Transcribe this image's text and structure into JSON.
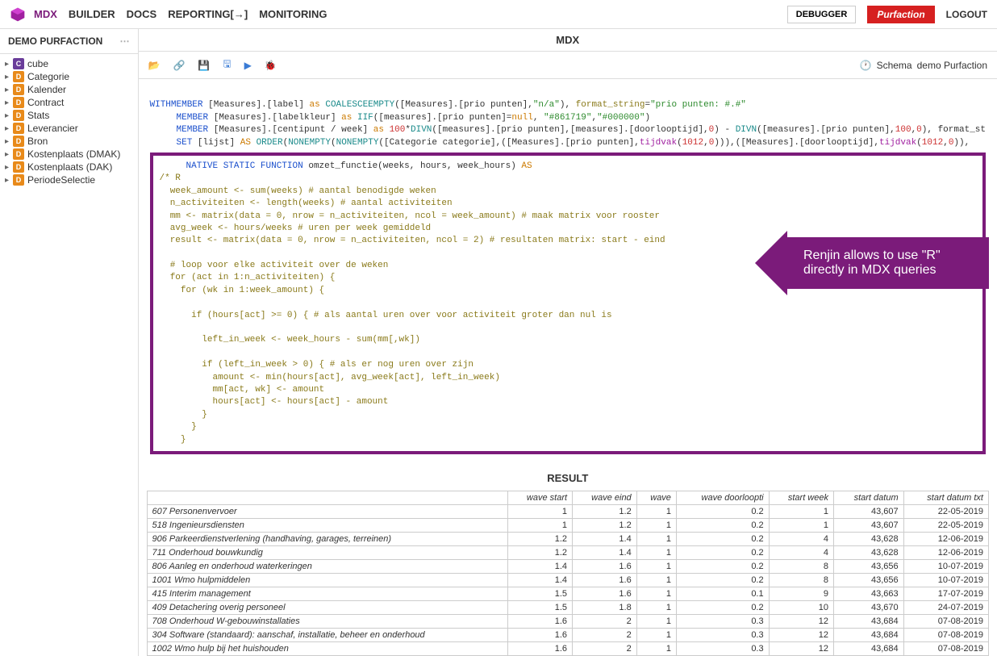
{
  "nav": {
    "items": [
      "MDX",
      "BUILDER",
      "DOCS",
      "REPORTING[→]",
      "MONITORING"
    ],
    "active": 0
  },
  "topbar": {
    "debugger": "DEBUGGER",
    "brand": "Purfaction",
    "logout": "LOGOUT"
  },
  "sidebar": {
    "title": "DEMO PURFACTION",
    "items": [
      {
        "badge": "C",
        "label": "cube"
      },
      {
        "badge": "D",
        "label": "Categorie"
      },
      {
        "badge": "D",
        "label": "Kalender"
      },
      {
        "badge": "D",
        "label": "Contract"
      },
      {
        "badge": "D",
        "label": "Stats"
      },
      {
        "badge": "D",
        "label": "Leverancier"
      },
      {
        "badge": "D",
        "label": "Bron"
      },
      {
        "badge": "D",
        "label": "Kostenplaats (DMAK)"
      },
      {
        "badge": "D",
        "label": "Kostenplaats (DAK)"
      },
      {
        "badge": "D",
        "label": "PeriodeSelectie"
      }
    ]
  },
  "section": {
    "mdx": "MDX",
    "result": "RESULT"
  },
  "toolbar": {
    "schema_label": "Schema",
    "schema_value": "demo Purfaction"
  },
  "callout": {
    "line1": "Renjin allows to use \"R\"",
    "line2": "directly in MDX queries"
  },
  "code": {
    "with": "WITH",
    "member": "MEMBER",
    "as": "as",
    "AS": "AS",
    "set": "SET",
    "m1": " [Measures].[label] ",
    "coal": "COALESCEEMPTY",
    "coal_args": "([Measures].[prio punten],",
    "na": "\"n/a\"",
    "paren": "),",
    "fs": " format_string",
    "eq": "=",
    "fs_val": "\"prio punten: #.#\"",
    "m2": " [Measures].[labelkleur] ",
    "iif": "IIF",
    "iif_args": "([measures].[prio punten]=",
    "null": "null",
    "c1": "\"#861719\"",
    "c2": "\"#000000\"",
    "m3": " [Measures].[centipunt / week] ",
    "hundred": "100",
    "star": "*",
    "divn": "DIVN",
    "divn1": "([measures].[prio punten],[measures].[doorlooptijd],",
    "zero": "0",
    "minus": " - ",
    "divn2": "([measures].[prio punten],",
    "h100": "100",
    "divn3": "), format_st",
    "lijst": " [lijst] ",
    "order": "ORDER",
    "none": "NONEMPTY",
    "none_args": "([Categorie categorie],([Measures].[prio punten],",
    "tijdvak": "tijdvak",
    "t1": "(",
    "n1012": "1012",
    "t2": ",",
    "t3": "))),([Measures].[doorlooptijd],",
    "t4": ")),",
    "nsf": "NATIVE STATIC FUNCTION",
    "nsf_tail": " omzet_functie(weeks, hours, week_hours) ",
    "r_body": "/* R\n  week_amount <- sum(weeks) # aantal benodigde weken\n  n_activiteiten <- length(weeks) # aantal activiteiten\n  mm <- matrix(data = 0, nrow = n_activiteiten, ncol = week_amount) # maak matrix voor rooster\n  avg_week <- hours/weeks # uren per week gemiddeld\n  result <- matrix(data = 0, nrow = n_activiteiten, ncol = 2) # resultaten matrix: start - eind\n\n  # loop voor elke activiteit over de weken\n  for (act in 1:n_activiteiten) {\n    for (wk in 1:week_amount) {\n\n      if (hours[act] >= 0) { # als aantal uren over voor activiteit groter dan nul is\n\n        left_in_week <- week_hours - sum(mm[,wk])\n\n        if (left_in_week > 0) { # als er nog uren over zijn\n          amount <- min(hours[act], avg_week[act], left_in_week)\n          mm[act, wk] <- amount\n          hours[act] <- hours[act] - amount\n        }\n      }\n    }"
  },
  "result": {
    "headers": [
      "",
      "wave start",
      "wave eind",
      "wave",
      "wave doorloopti",
      "start week",
      "start datum",
      "start datum txt"
    ],
    "rows": [
      [
        "607 Personenvervoer",
        "1",
        "1.2",
        "1",
        "0.2",
        "1",
        "43,607",
        "22-05-2019"
      ],
      [
        "518 Ingenieursdiensten",
        "1",
        "1.2",
        "1",
        "0.2",
        "1",
        "43,607",
        "22-05-2019"
      ],
      [
        "906 Parkeerdienstverlening (handhaving, garages, terreinen)",
        "1.2",
        "1.4",
        "1",
        "0.2",
        "4",
        "43,628",
        "12-06-2019"
      ],
      [
        "711 Onderhoud bouwkundig",
        "1.2",
        "1.4",
        "1",
        "0.2",
        "4",
        "43,628",
        "12-06-2019"
      ],
      [
        "806 Aanleg en onderhoud waterkeringen",
        "1.4",
        "1.6",
        "1",
        "0.2",
        "8",
        "43,656",
        "10-07-2019"
      ],
      [
        "1001 Wmo hulpmiddelen",
        "1.4",
        "1.6",
        "1",
        "0.2",
        "8",
        "43,656",
        "10-07-2019"
      ],
      [
        "415 Interim management",
        "1.5",
        "1.6",
        "1",
        "0.1",
        "9",
        "43,663",
        "17-07-2019"
      ],
      [
        "409 Detachering overig personeel",
        "1.5",
        "1.8",
        "1",
        "0.2",
        "10",
        "43,670",
        "24-07-2019"
      ],
      [
        "708 Onderhoud W-gebouwinstallaties",
        "1.6",
        "2",
        "1",
        "0.3",
        "12",
        "43,684",
        "07-08-2019"
      ],
      [
        "304 Software (standaard): aanschaf, installatie, beheer en onderhoud",
        "1.6",
        "2",
        "1",
        "0.3",
        "12",
        "43,684",
        "07-08-2019"
      ],
      [
        "1002 Wmo hulp bij het huishouden",
        "1.6",
        "2",
        "1",
        "0.3",
        "12",
        "43,684",
        "07-08-2019"
      ]
    ]
  }
}
